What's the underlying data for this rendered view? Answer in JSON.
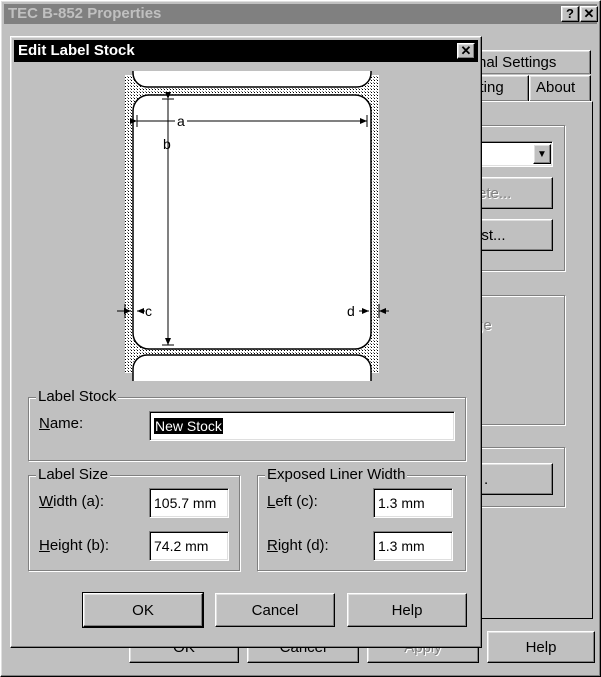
{
  "parent": {
    "title": "TEC B-852 Properties",
    "tabs": [
      "nal Settings",
      "sting",
      "About"
    ],
    "partial_button_1": "ete...",
    "partial_button_2": "ist...",
    "partial_group_label": "ge",
    "partial_button_3": ".",
    "bottom_buttons": {
      "ok": "OK",
      "cancel": "Cancel",
      "apply": "Apply",
      "help": "Help"
    }
  },
  "dialog": {
    "title": "Edit Label Stock",
    "diagram": {
      "a": "a",
      "b": "b",
      "c": "c",
      "d": "d"
    },
    "label_stock": {
      "group": "Label Stock",
      "name_label_u": "N",
      "name_label_rest": "ame:",
      "name_value": "New Stock"
    },
    "label_size": {
      "group": "Label Size",
      "width_label_u": "W",
      "width_label_rest": "idth (a):",
      "width_value": "105.7 mm",
      "height_label_u": "H",
      "height_label_rest": "eight (b):",
      "height_value": "74.2 mm"
    },
    "liner": {
      "group": "Exposed Liner Width",
      "left_label_u": "L",
      "left_label_rest": "eft (c):",
      "left_value": "1.3 mm",
      "right_label_u": "R",
      "right_label_rest": "ight (d):",
      "right_value": "1.3 mm"
    },
    "buttons": {
      "ok": "OK",
      "cancel": "Cancel",
      "help": "Help"
    }
  }
}
